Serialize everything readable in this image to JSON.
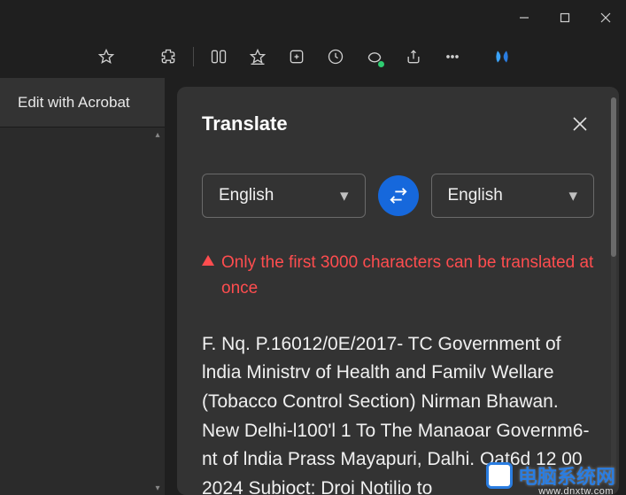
{
  "window": {
    "minimize": "minimize",
    "maximize": "maximize",
    "close": "close"
  },
  "toolbar": {
    "favorite": "favorite",
    "extensions": "extensions",
    "split": "split-screen",
    "favorites_list": "favorites",
    "collections": "collections",
    "history": "history",
    "performance": "performance",
    "share": "share",
    "more": "more",
    "copilot": "copilot"
  },
  "sidebar": {
    "acrobat_label": "Edit with Acrobat"
  },
  "panel": {
    "title": "Translate",
    "close": "close",
    "lang_from": "English",
    "lang_to": "English",
    "swap": "swap",
    "warning_text": "Only the first 3000 characters can be translated at once",
    "translated_text": "F. Nq. P.16012/0E/2017- TC Government of lndia Ministrv of Health and Familv Wellare (Tobacco Control Section) Nirman Bhawan. New Delhi-l100'l 1 To The Manaoar Governm6-nt of lndia Prass Mayapuri, Dalhi. Oat6d 12 00 2024 Subioct: Droi Notilio to"
  },
  "watermark": {
    "text": "电脑系统网",
    "url": "www.dnxtw.com"
  }
}
